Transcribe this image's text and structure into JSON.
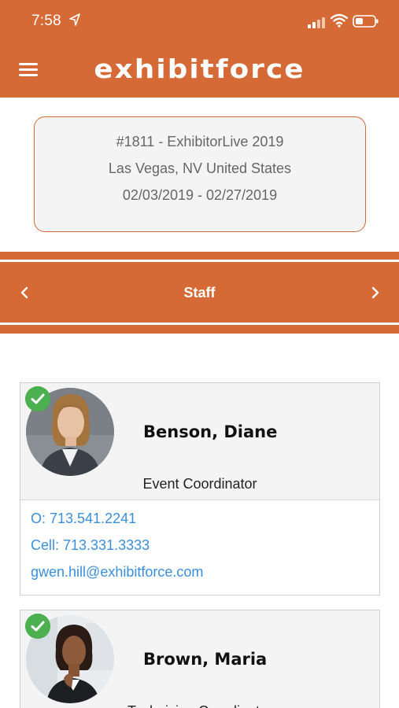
{
  "status_bar": {
    "time": "7:58",
    "icons": [
      "location-arrow-icon",
      "signal-icon",
      "wifi-icon",
      "battery-icon"
    ]
  },
  "header": {
    "menu_icon": "hamburger-icon",
    "brand": "exhibitforce",
    "color": "#d66a36"
  },
  "event": {
    "title": "#1811 - ExhibitorLive 2019",
    "location": "Las Vegas, NV United States",
    "dates": "02/03/2019 - 02/27/2019"
  },
  "section_nav": {
    "title": "Staff",
    "prev_icon": "chevron-left-icon",
    "next_icon": "chevron-right-icon"
  },
  "staff": [
    {
      "name": "Benson, Diane",
      "role": "Event Coordinator",
      "office": "O: 713.541.2241",
      "cell": "Cell: 713.331.3333",
      "email": "gwen.hill@exhibitforce.com",
      "checked": true
    },
    {
      "name": "Brown, Maria",
      "role": "Technician Coordinator",
      "checked": true
    }
  ],
  "colors": {
    "accent": "#d66a36",
    "link": "#3a8fdc",
    "check": "#4caf50"
  }
}
